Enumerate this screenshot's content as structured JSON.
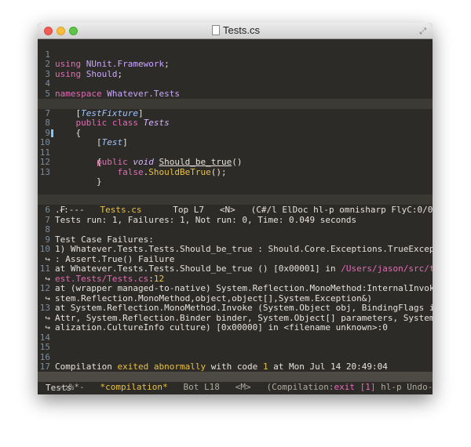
{
  "window": {
    "title": "Tests.cs"
  },
  "editor": {
    "lines": [
      {
        "n": "1",
        "t": "using NUnit.Framework;"
      },
      {
        "n": "2",
        "t": "using Should;"
      },
      {
        "n": "3",
        "t": ""
      },
      {
        "n": "4",
        "t": "namespace Whatever.Tests"
      },
      {
        "n": "5",
        "t": "{"
      },
      {
        "n": "6",
        "t": "    [TestFixture]"
      },
      {
        "n": "7",
        "t": "    public class Tests"
      },
      {
        "n": "8",
        "t": "    {"
      },
      {
        "n": "9",
        "t": "        [Test]"
      },
      {
        "n": "10",
        "t": "        public void Should_be_true()"
      },
      {
        "n": "11",
        "t": "        {"
      },
      {
        "n": "12",
        "t": "            false.ShouldBeTrue();"
      },
      {
        "n": "13",
        "t": "        }"
      }
    ]
  },
  "modeline1": {
    "state": "-:---",
    "buffer": "Tests.cs",
    "pos": "Top L7",
    "mode": "<N>",
    "rest": "(C#/l ElDoc hl-p omnisharp FlyC:0/0 company"
  },
  "compilation": {
    "lines": [
      {
        "n": "6",
        "t": ".F"
      },
      {
        "n": "7",
        "t": "Tests run: 1, Failures: 1, Not run: 0, Time: 0.049 seconds"
      },
      {
        "n": "8",
        "t": ""
      },
      {
        "n": "9",
        "t": "Test Case Failures:"
      },
      {
        "n": "10",
        "t": "1) Whatever.Tests.Tests.Should_be_true : Should.Core.Exceptions.TrueException ↩"
      },
      {
        "n": "",
        "t": ": Assert.True() Failure"
      },
      {
        "n": "11",
        "t": "at Whatever.Tests.Tests.Should_be_true () [0x00001] in /Users/jason/src/test/t"
      },
      {
        "n": "",
        "t": "est.Tests/Tests.cs:12"
      },
      {
        "n": "12",
        "t": "at (wrapper managed-to-native) System.Reflection.MonoMethod:InternalInvoke (Sy"
      },
      {
        "n": "",
        "t": "stem.Reflection.MonoMethod,object,object[],System.Exception&)"
      },
      {
        "n": "13",
        "t": "at System.Reflection.MonoMethod.Invoke (System.Object obj, BindingFlags invoke"
      },
      {
        "n": "",
        "t": "Attr, System.Reflection.Binder binder, System.Object[] parameters, System.Glob"
      },
      {
        "n": "",
        "t": "alization.CultureInfo culture) [0x00000] in <filename unknown>:0"
      },
      {
        "n": "14",
        "t": ""
      },
      {
        "n": "15",
        "t": ""
      },
      {
        "n": "16",
        "t": ""
      },
      {
        "n": "17",
        "t": "Compilation exited abnormally with code 1 at Mon Jul 14 20:49:04"
      }
    ]
  },
  "modeline2": {
    "state": "-:%*-",
    "buffer": "*compilation*",
    "pos": "Bot L18",
    "mode": "<M>",
    "rest": "(Compilation:exit [1] hl-p Undo-Tree)"
  },
  "minibuffer": {
    "text": "Tests"
  }
}
